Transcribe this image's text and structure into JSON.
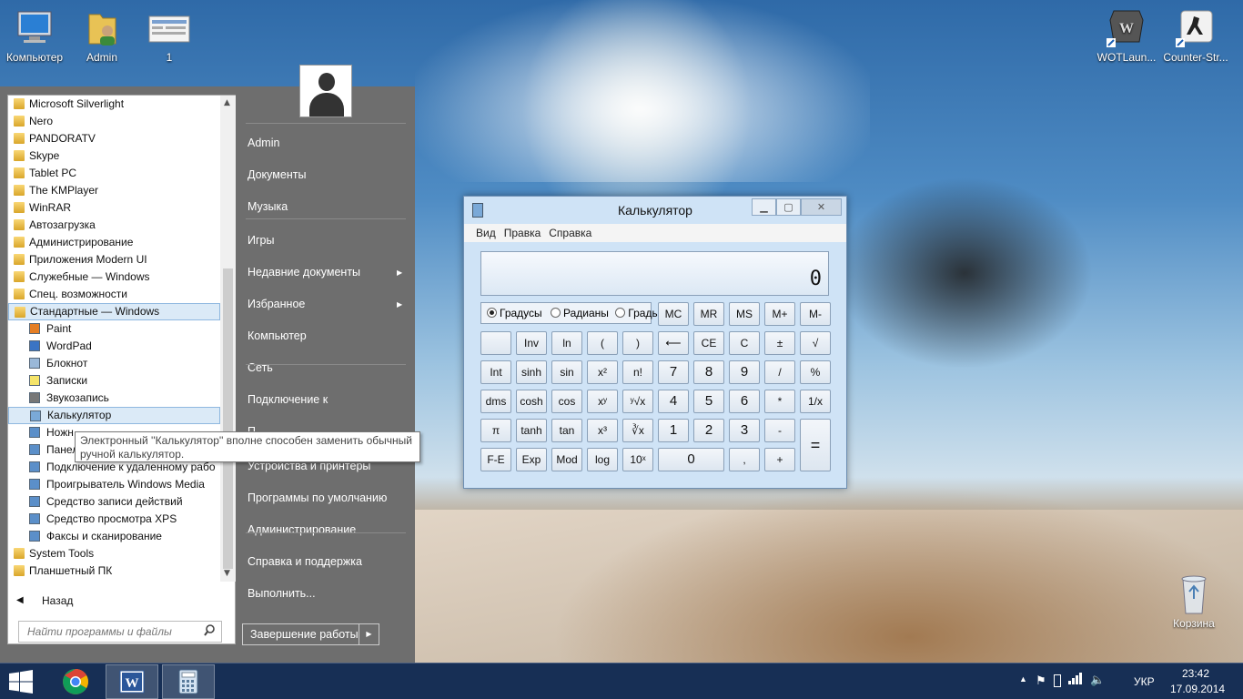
{
  "desktop": {
    "icons": [
      {
        "label": "Компьютер",
        "icon": "computer-icon"
      },
      {
        "label": "Admin",
        "icon": "user-folder-icon"
      },
      {
        "label": "1",
        "icon": "document-icon"
      },
      {
        "label": "WOTLaun...",
        "icon": "wot-shortcut-icon"
      },
      {
        "label": "Counter-Str...",
        "icon": "counter-strike-shortcut-icon"
      },
      {
        "label": "Корзина",
        "icon": "recycle-bin-icon"
      }
    ]
  },
  "start_menu": {
    "programs": [
      {
        "label": "Microsoft Silverlight",
        "type": "folder"
      },
      {
        "label": "Nero",
        "type": "folder"
      },
      {
        "label": "PANDORATV",
        "type": "folder"
      },
      {
        "label": "Skype",
        "type": "folder"
      },
      {
        "label": "Tablet PC",
        "type": "folder"
      },
      {
        "label": "The KMPlayer",
        "type": "folder"
      },
      {
        "label": "WinRAR",
        "type": "folder"
      },
      {
        "label": "Автозагрузка",
        "type": "folder"
      },
      {
        "label": "Администрирование",
        "type": "folder"
      },
      {
        "label": "Приложения Modern UI",
        "type": "folder"
      },
      {
        "label": "Служебные — Windows",
        "type": "folder"
      },
      {
        "label": "Спец. возможности",
        "type": "folder"
      },
      {
        "label": "Стандартные — Windows",
        "type": "folder-open"
      },
      {
        "label": "Paint",
        "type": "app"
      },
      {
        "label": "WordPad",
        "type": "app"
      },
      {
        "label": "Блокнот",
        "type": "app"
      },
      {
        "label": "Записки",
        "type": "app"
      },
      {
        "label": "Звукозапись",
        "type": "app"
      },
      {
        "label": "Калькулятор",
        "type": "app"
      },
      {
        "label": "Ножн",
        "type": "app"
      },
      {
        "label": "Панел",
        "type": "app"
      },
      {
        "label": "Подключение к удаленному рабо",
        "type": "app"
      },
      {
        "label": "Проигрыватель Windows Media",
        "type": "app"
      },
      {
        "label": "Средство записи действий",
        "type": "app"
      },
      {
        "label": "Средство просмотра XPS",
        "type": "app"
      },
      {
        "label": "Факсы и сканирование",
        "type": "app"
      },
      {
        "label": "System Tools",
        "type": "folder"
      },
      {
        "label": "Планшетный ПК",
        "type": "folder"
      }
    ],
    "back_label": "Назад",
    "search_placeholder": "Найти программы и файлы",
    "right_items": [
      {
        "label": "Admin",
        "arrow": false
      },
      {
        "label": "Документы",
        "arrow": false
      },
      {
        "label": "Музыка",
        "arrow": false
      },
      {
        "label": "Игры",
        "arrow": false
      },
      {
        "label": "Недавние документы",
        "arrow": true
      },
      {
        "label": "Избранное",
        "arrow": true
      },
      {
        "label": "Компьютер",
        "arrow": false
      },
      {
        "label": "Сеть",
        "arrow": false
      },
      {
        "label": "Подключение к",
        "arrow": false
      },
      {
        "label": "П",
        "arrow": false
      },
      {
        "label": "Устройства и принтеры",
        "arrow": false
      },
      {
        "label": "Программы по умолчанию",
        "arrow": false
      },
      {
        "label": "Администрирование",
        "arrow": false
      },
      {
        "label": "Справка и поддержка",
        "arrow": false
      },
      {
        "label": "Выполнить...",
        "arrow": false
      }
    ],
    "shutdown_label": "Завершение работы",
    "tooltip": "Электронный ''Калькулятор'' вполне способен заменить обычный ручной калькулятор."
  },
  "calculator": {
    "title": "Калькулятор",
    "menu": [
      "Вид",
      "Правка",
      "Справка"
    ],
    "display": "0",
    "angle_modes": [
      {
        "label": "Градусы",
        "selected": true
      },
      {
        "label": "Радианы",
        "selected": false
      },
      {
        "label": "Грады",
        "selected": false
      }
    ],
    "memory_buttons": [
      "MC",
      "MR",
      "MS",
      "M+",
      "M-"
    ],
    "rows": [
      [
        "",
        "Inv",
        "ln",
        "(",
        ")",
        "⟵",
        "CE",
        "C",
        "±",
        "√"
      ],
      [
        "Int",
        "sinh",
        "sin",
        "x²",
        "n!",
        "7",
        "8",
        "9",
        "/",
        "%"
      ],
      [
        "dms",
        "cosh",
        "cos",
        "xʸ",
        "ʸ√x",
        "4",
        "5",
        "6",
        "*",
        "1/x"
      ],
      [
        "π",
        "tanh",
        "tan",
        "x³",
        "∛x",
        "1",
        "2",
        "3",
        "-",
        "="
      ],
      [
        "F-E",
        "Exp",
        "Mod",
        "log",
        "10ˣ",
        "0",
        ",",
        "+"
      ]
    ]
  },
  "taskbar": {
    "items": [
      "start-button",
      "chrome",
      "word",
      "calculator"
    ],
    "language": "УКР",
    "time": "23:42",
    "date": "17.09.2014"
  }
}
